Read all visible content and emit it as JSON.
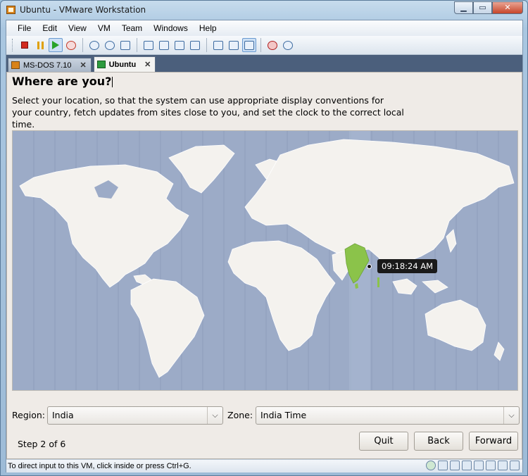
{
  "window": {
    "title": "Ubuntu - VMware Workstation",
    "min": "▁",
    "max": "▭",
    "close": "✕"
  },
  "menu": [
    "File",
    "Edit",
    "View",
    "VM",
    "Team",
    "Windows",
    "Help"
  ],
  "tabs": [
    {
      "label": "MS-DOS 7.10",
      "close": "✕"
    },
    {
      "label": "Ubuntu",
      "close": "✕"
    }
  ],
  "installer": {
    "heading": "Where are you?",
    "description": "Select your location, so that the system can use appropriate display conventions for your country, fetch updates from sites close to you, and set the clock to the correct local time.",
    "time_tooltip": "09:18:24 AM",
    "region_label": "Region:",
    "region_value": "India",
    "zone_label": "Zone:",
    "zone_value": "India Time",
    "dropdown_arrow": "⌵",
    "step": "Step 2 of 6",
    "buttons": {
      "quit": "Quit",
      "back": "Back",
      "forward": "Forward"
    }
  },
  "status_text": "To direct input to this VM, click inside or press Ctrl+G.",
  "colors": {
    "ocean": "#9cabc7",
    "land": "#f4f2ee",
    "highlight": "#8bc34a",
    "accent": "#4b5f7c"
  }
}
